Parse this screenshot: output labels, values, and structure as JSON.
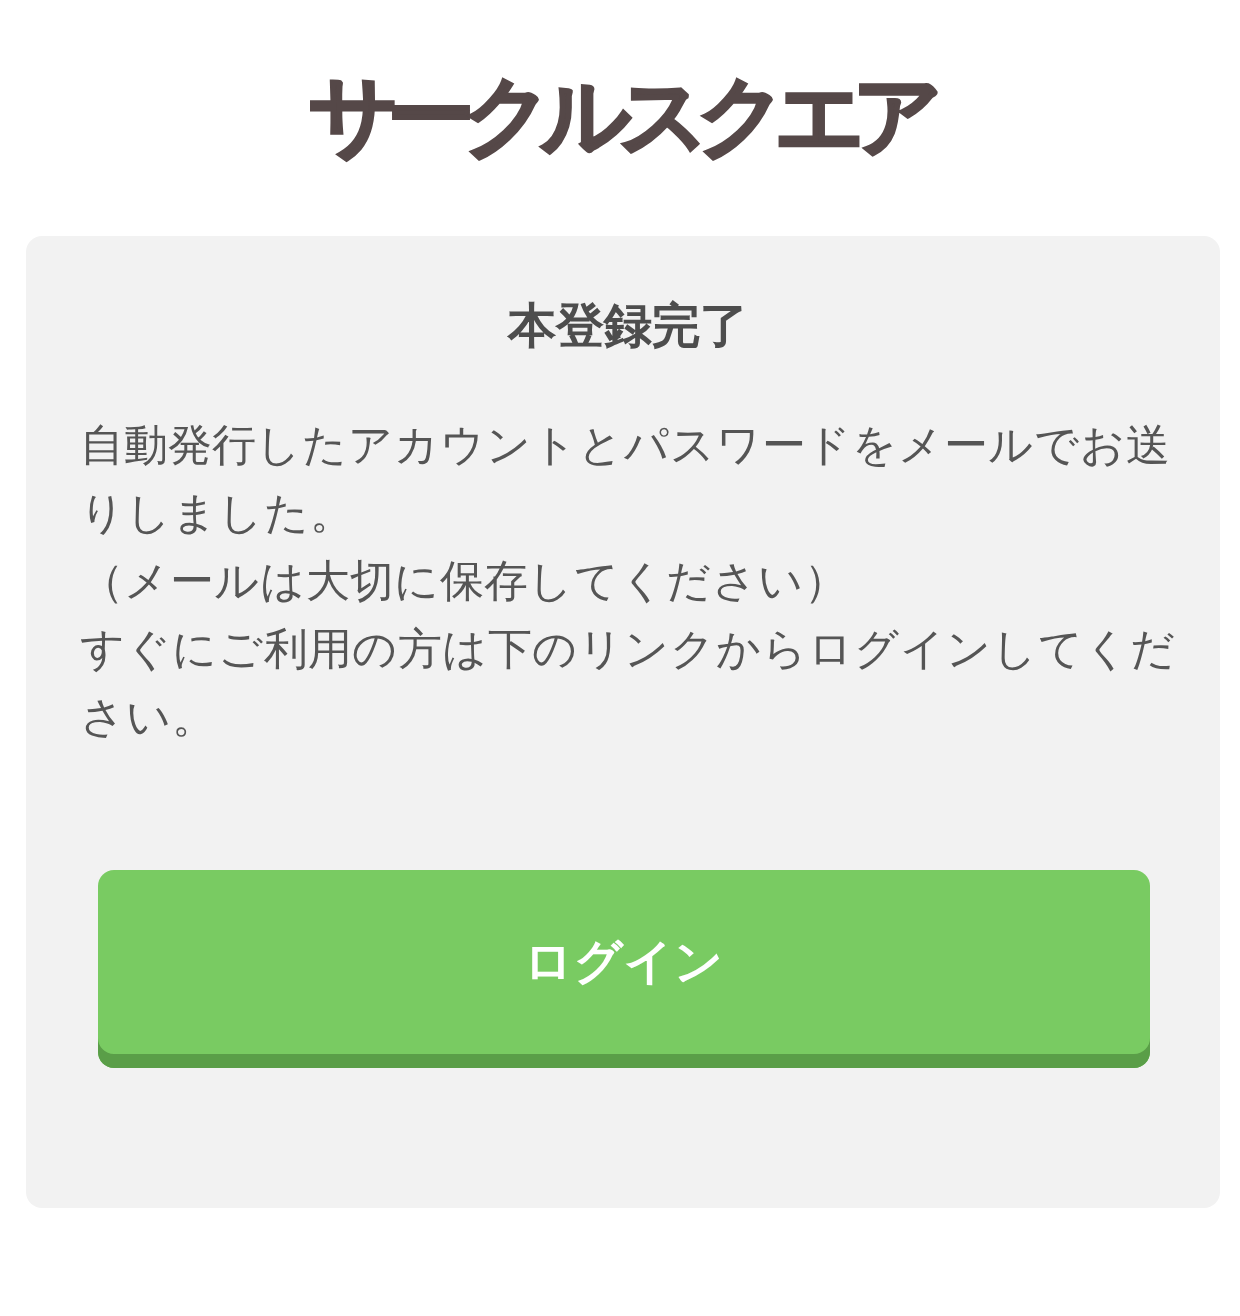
{
  "logo": {
    "text": "サークルスクエア"
  },
  "card": {
    "title": "本登録完了",
    "message": [
      "自動発行したアカウントとパスワードをメールでお送りしました。",
      "（メールは大切に保存してください）",
      "すぐにご利用の方は下のリンクからログインしてください。"
    ],
    "button": {
      "label": "ログイン"
    }
  }
}
